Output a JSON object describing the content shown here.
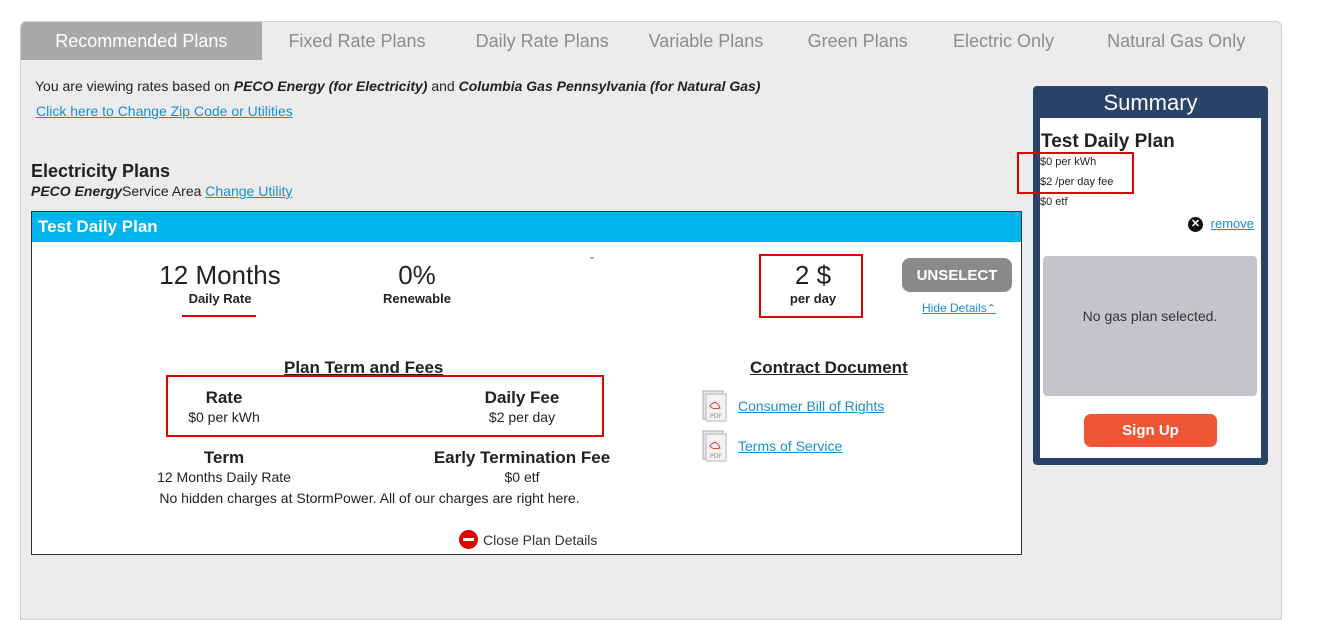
{
  "tabs": [
    {
      "label": "Recommended Plans",
      "active": true
    },
    {
      "label": "Fixed Rate Plans",
      "active": false
    },
    {
      "label": "Daily Rate Plans",
      "active": false
    },
    {
      "label": "Variable Plans",
      "active": false
    },
    {
      "label": "Green Plans",
      "active": false
    },
    {
      "label": "Electric Only",
      "active": false
    },
    {
      "label": "Natural Gas Only",
      "active": false
    }
  ],
  "viewing": {
    "prefix": "You are viewing rates based on",
    "electric_utility": "PECO Energy (for Electricity)",
    "and": "and",
    "gas_utility": "Columbia Gas Pennsylvania (for Natural Gas)",
    "change_link": "Click here to Change Zip Code or Utilities"
  },
  "electricity": {
    "title": "Electricity Plans",
    "utility_name": "PECO Energy",
    "service_area": "Service Area",
    "change_utility": "Change Utility"
  },
  "plan": {
    "name": "Test Daily Plan",
    "term_value": "12 Months",
    "term_label": "Daily Rate",
    "renewable_value": "0%",
    "renewable_label": "Renewable",
    "dash": "-",
    "price_value": "2 $",
    "price_label": "per day",
    "unselect_label": "UNSELECT",
    "hide_details": "Hide Details",
    "terms_title": "Plan Term and Fees",
    "rate_label": "Rate",
    "rate_value": "$0 per kWh",
    "daily_fee_label": "Daily Fee",
    "daily_fee_value": "$2 per day",
    "term_label2": "Term",
    "term_value2": "12 Months Daily Rate",
    "etf_label": "Early Termination Fee",
    "etf_value": "$0 etf",
    "note": "No hidden charges at StormPower. All of our charges are right here.",
    "contract_title": "Contract Document",
    "doc1": "Consumer Bill of Rights",
    "doc2": "Terms of Service",
    "close_details": "Close Plan Details"
  },
  "summary": {
    "title": "Summary",
    "plan_name": "Test Daily Plan",
    "line1": "$0 per kWh",
    "line2": "$2 /per day fee",
    "line3": "$0 etf",
    "remove": "remove",
    "no_gas": "No gas plan selected.",
    "signup": "Sign Up"
  },
  "colors": {
    "accent_blue": "#00b4ec",
    "link_blue": "#1a8fd0",
    "summary_navy": "#2c4369",
    "signup_orange": "#f05535",
    "highlight_red": "#e00000"
  }
}
